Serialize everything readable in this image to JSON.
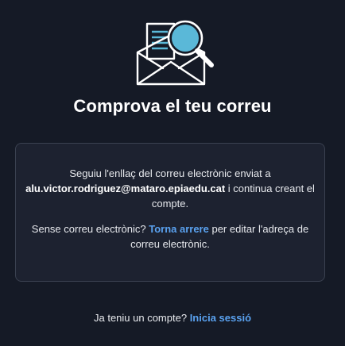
{
  "illustration": {
    "icon": "mail-search-icon",
    "accent_color": "#5ab8d8"
  },
  "heading": "Comprova el teu correu",
  "card": {
    "line1_prefix": "Seguiu l'enllaç del correu electrònic enviat a",
    "email": "alu.victor.rodriguez@mataro.epiaedu.cat",
    "line1_suffix": " i continua creant el compte.",
    "line2_prefix": "Sense correu electrònic? ",
    "back_link": "Torna arrere",
    "line2_suffix": " per editar l'adreça de correu electrònic."
  },
  "footer": {
    "prompt": "Ja teniu un compte? ",
    "signin_link": "Inicia sessió"
  },
  "colors": {
    "background": "#151a26",
    "card_background": "#1d2230",
    "link": "#5aa2f0"
  }
}
